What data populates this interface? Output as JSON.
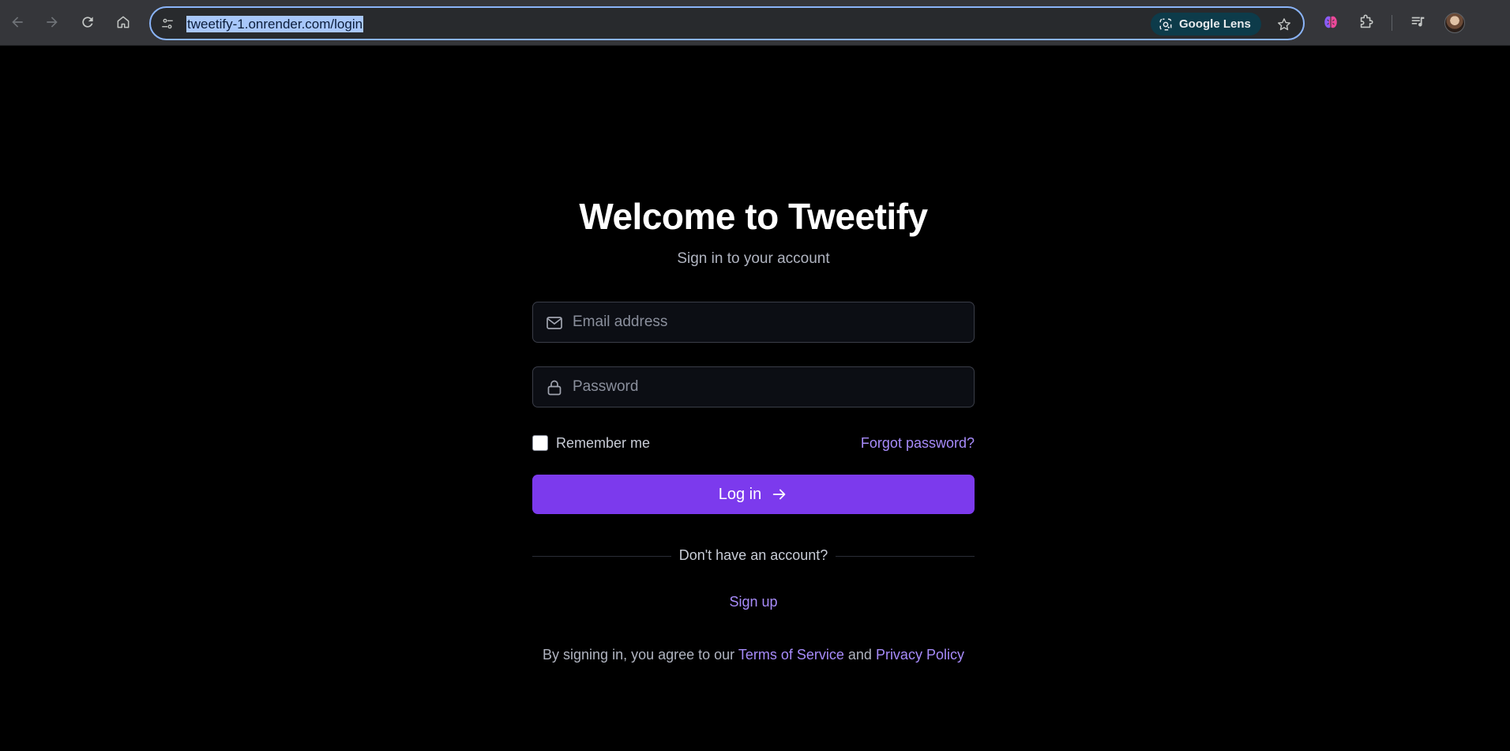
{
  "browser": {
    "url": "tweetify-1.onrender.com/login",
    "lens_label": "Google Lens",
    "icons": {
      "back": "arrow-left-icon",
      "forward": "arrow-right-icon",
      "reload": "reload-icon",
      "home": "home-icon",
      "site_info": "tune-icon",
      "lens": "lens-icon",
      "bookmark": "star-icon",
      "extension_ai": "brain-icon",
      "extensions": "puzzle-icon",
      "media": "media-queue-icon",
      "profile": "avatar"
    }
  },
  "login": {
    "title": "Welcome to Tweetify",
    "subtitle": "Sign in to your account",
    "email": {
      "placeholder": "Email address",
      "value": "",
      "icon": "mail-icon"
    },
    "password": {
      "placeholder": "Password",
      "value": "",
      "icon": "lock-icon"
    },
    "remember_label": "Remember me",
    "remember_checked": false,
    "forgot_label": "Forgot password?",
    "login_label": "Log in",
    "divider_text": "Don't have an account?",
    "signup_label": "Sign up",
    "terms": {
      "prefix": "By signing in, you agree to our ",
      "tos": "Terms of Service",
      "and": " and ",
      "privacy": "Privacy Policy"
    }
  },
  "colors": {
    "accent": "#7c3aed",
    "link": "#a78bfa",
    "background": "#000000",
    "input_bg": "#0c0e14"
  }
}
